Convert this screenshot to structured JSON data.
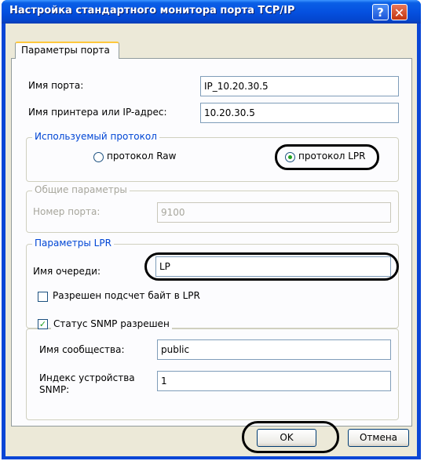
{
  "window": {
    "title": "Настройка стандартного монитора порта TCP/IP",
    "help_glyph": "?",
    "close_glyph": "✕"
  },
  "tabs": [
    {
      "label": "Параметры порта",
      "selected": true
    }
  ],
  "port": {
    "port_name_label": "Имя порта:",
    "port_name_value": "IP_10.20.30.5",
    "printer_label": "Имя принтера или IP-адрес:",
    "printer_value": "10.20.30.5"
  },
  "protocol": {
    "group_title": "Используемый протокол",
    "raw_label": "протокол Raw",
    "lpr_label": "протокол LPR",
    "selected": "LPR"
  },
  "general": {
    "group_title": "Общие параметры",
    "port_number_label": "Номер порта:",
    "port_number_value": "9100"
  },
  "lpr": {
    "group_title": "Параметры LPR",
    "queue_label": "Имя очереди:",
    "queue_value": "LP",
    "byte_count_label": "Разрешен подсчет байт в LPR",
    "byte_count_checked": false
  },
  "snmp": {
    "enabled_label": "Статус SNMP разрешен",
    "enabled_checked": true,
    "community_label": "Имя сообщества:",
    "community_value": "public",
    "device_index_label_line1": "Индекс устройства",
    "device_index_label_line2": "SNMP:",
    "device_index_value": "1"
  },
  "buttons": {
    "ok": "OK",
    "cancel": "Отмена"
  },
  "colors": {
    "title_bar": "#0551e0",
    "dialog_bg": "#ece9d8",
    "highlight_outline": "#000000",
    "radio_dot": "#21a121"
  }
}
